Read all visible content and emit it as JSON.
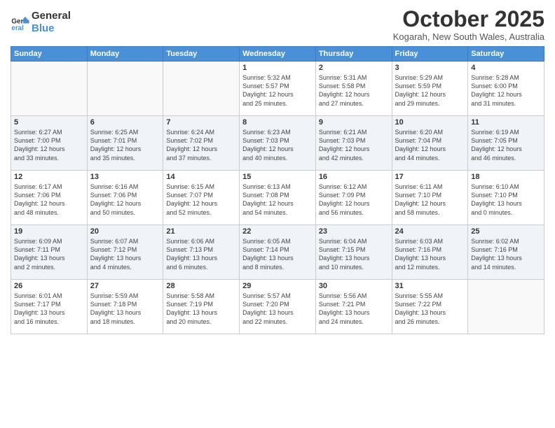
{
  "logo": {
    "line1": "General",
    "line2": "Blue"
  },
  "title": "October 2025",
  "location": "Kogarah, New South Wales, Australia",
  "weekdays": [
    "Sunday",
    "Monday",
    "Tuesday",
    "Wednesday",
    "Thursday",
    "Friday",
    "Saturday"
  ],
  "weeks": [
    [
      {
        "day": "",
        "info": ""
      },
      {
        "day": "",
        "info": ""
      },
      {
        "day": "",
        "info": ""
      },
      {
        "day": "1",
        "info": "Sunrise: 5:32 AM\nSunset: 5:57 PM\nDaylight: 12 hours\nand 25 minutes."
      },
      {
        "day": "2",
        "info": "Sunrise: 5:31 AM\nSunset: 5:58 PM\nDaylight: 12 hours\nand 27 minutes."
      },
      {
        "day": "3",
        "info": "Sunrise: 5:29 AM\nSunset: 5:59 PM\nDaylight: 12 hours\nand 29 minutes."
      },
      {
        "day": "4",
        "info": "Sunrise: 5:28 AM\nSunset: 6:00 PM\nDaylight: 12 hours\nand 31 minutes."
      }
    ],
    [
      {
        "day": "5",
        "info": "Sunrise: 6:27 AM\nSunset: 7:00 PM\nDaylight: 12 hours\nand 33 minutes."
      },
      {
        "day": "6",
        "info": "Sunrise: 6:25 AM\nSunset: 7:01 PM\nDaylight: 12 hours\nand 35 minutes."
      },
      {
        "day": "7",
        "info": "Sunrise: 6:24 AM\nSunset: 7:02 PM\nDaylight: 12 hours\nand 37 minutes."
      },
      {
        "day": "8",
        "info": "Sunrise: 6:23 AM\nSunset: 7:03 PM\nDaylight: 12 hours\nand 40 minutes."
      },
      {
        "day": "9",
        "info": "Sunrise: 6:21 AM\nSunset: 7:03 PM\nDaylight: 12 hours\nand 42 minutes."
      },
      {
        "day": "10",
        "info": "Sunrise: 6:20 AM\nSunset: 7:04 PM\nDaylight: 12 hours\nand 44 minutes."
      },
      {
        "day": "11",
        "info": "Sunrise: 6:19 AM\nSunset: 7:05 PM\nDaylight: 12 hours\nand 46 minutes."
      }
    ],
    [
      {
        "day": "12",
        "info": "Sunrise: 6:17 AM\nSunset: 7:06 PM\nDaylight: 12 hours\nand 48 minutes."
      },
      {
        "day": "13",
        "info": "Sunrise: 6:16 AM\nSunset: 7:06 PM\nDaylight: 12 hours\nand 50 minutes."
      },
      {
        "day": "14",
        "info": "Sunrise: 6:15 AM\nSunset: 7:07 PM\nDaylight: 12 hours\nand 52 minutes."
      },
      {
        "day": "15",
        "info": "Sunrise: 6:13 AM\nSunset: 7:08 PM\nDaylight: 12 hours\nand 54 minutes."
      },
      {
        "day": "16",
        "info": "Sunrise: 6:12 AM\nSunset: 7:09 PM\nDaylight: 12 hours\nand 56 minutes."
      },
      {
        "day": "17",
        "info": "Sunrise: 6:11 AM\nSunset: 7:10 PM\nDaylight: 12 hours\nand 58 minutes."
      },
      {
        "day": "18",
        "info": "Sunrise: 6:10 AM\nSunset: 7:10 PM\nDaylight: 13 hours\nand 0 minutes."
      }
    ],
    [
      {
        "day": "19",
        "info": "Sunrise: 6:09 AM\nSunset: 7:11 PM\nDaylight: 13 hours\nand 2 minutes."
      },
      {
        "day": "20",
        "info": "Sunrise: 6:07 AM\nSunset: 7:12 PM\nDaylight: 13 hours\nand 4 minutes."
      },
      {
        "day": "21",
        "info": "Sunrise: 6:06 AM\nSunset: 7:13 PM\nDaylight: 13 hours\nand 6 minutes."
      },
      {
        "day": "22",
        "info": "Sunrise: 6:05 AM\nSunset: 7:14 PM\nDaylight: 13 hours\nand 8 minutes."
      },
      {
        "day": "23",
        "info": "Sunrise: 6:04 AM\nSunset: 7:15 PM\nDaylight: 13 hours\nand 10 minutes."
      },
      {
        "day": "24",
        "info": "Sunrise: 6:03 AM\nSunset: 7:16 PM\nDaylight: 13 hours\nand 12 minutes."
      },
      {
        "day": "25",
        "info": "Sunrise: 6:02 AM\nSunset: 7:16 PM\nDaylight: 13 hours\nand 14 minutes."
      }
    ],
    [
      {
        "day": "26",
        "info": "Sunrise: 6:01 AM\nSunset: 7:17 PM\nDaylight: 13 hours\nand 16 minutes."
      },
      {
        "day": "27",
        "info": "Sunrise: 5:59 AM\nSunset: 7:18 PM\nDaylight: 13 hours\nand 18 minutes."
      },
      {
        "day": "28",
        "info": "Sunrise: 5:58 AM\nSunset: 7:19 PM\nDaylight: 13 hours\nand 20 minutes."
      },
      {
        "day": "29",
        "info": "Sunrise: 5:57 AM\nSunset: 7:20 PM\nDaylight: 13 hours\nand 22 minutes."
      },
      {
        "day": "30",
        "info": "Sunrise: 5:56 AM\nSunset: 7:21 PM\nDaylight: 13 hours\nand 24 minutes."
      },
      {
        "day": "31",
        "info": "Sunrise: 5:55 AM\nSunset: 7:22 PM\nDaylight: 13 hours\nand 26 minutes."
      },
      {
        "day": "",
        "info": ""
      }
    ]
  ]
}
